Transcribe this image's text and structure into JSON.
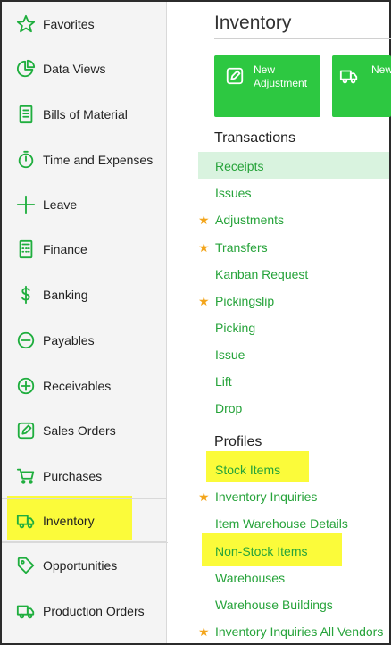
{
  "sidebar": {
    "items": [
      {
        "label": "Favorites",
        "icon": "star-icon"
      },
      {
        "label": "Data Views",
        "icon": "pie-chart-icon"
      },
      {
        "label": "Bills of Material",
        "icon": "document-list-icon"
      },
      {
        "label": "Time and Expenses",
        "icon": "stopwatch-icon"
      },
      {
        "label": "Leave",
        "icon": "plus-icon"
      },
      {
        "label": "Finance",
        "icon": "calculator-icon"
      },
      {
        "label": "Banking",
        "icon": "dollar-icon"
      },
      {
        "label": "Payables",
        "icon": "minus-circle-icon"
      },
      {
        "label": "Receivables",
        "icon": "plus-circle-icon"
      },
      {
        "label": "Sales Orders",
        "icon": "pencil-square-icon"
      },
      {
        "label": "Purchases",
        "icon": "cart-icon"
      },
      {
        "label": "Inventory",
        "icon": "truck-icon"
      },
      {
        "label": "Opportunities",
        "icon": "tag-icon"
      },
      {
        "label": "Production Orders",
        "icon": "truck-icon"
      }
    ],
    "active": "Inventory"
  },
  "main": {
    "title": "Inventory",
    "tiles": [
      {
        "label": "New Adjustment",
        "icon": "pencil-square-icon"
      },
      {
        "label": "New Transfer",
        "icon": "truck-icon"
      }
    ],
    "transactions": {
      "heading": "Transactions",
      "links": [
        {
          "label": "Receipts",
          "starred": false,
          "selected": true
        },
        {
          "label": "Issues",
          "starred": false
        },
        {
          "label": "Adjustments",
          "starred": true
        },
        {
          "label": "Transfers",
          "starred": true
        },
        {
          "label": "Kanban Request",
          "starred": false
        },
        {
          "label": "Pickingslip",
          "starred": true
        },
        {
          "label": "Picking",
          "starred": false
        },
        {
          "label": "Issue",
          "starred": false
        },
        {
          "label": "Lift",
          "starred": false
        },
        {
          "label": "Drop",
          "starred": false
        }
      ]
    },
    "profiles": {
      "heading": "Profiles",
      "links": [
        {
          "label": "Stock Items",
          "starred": false,
          "highlighted": true
        },
        {
          "label": "Inventory Inquiries",
          "starred": true
        },
        {
          "label": "Item Warehouse Details",
          "starred": false
        },
        {
          "label": "Non-Stock Items",
          "starred": false,
          "highlighted": true
        },
        {
          "label": "Warehouses",
          "starred": false
        },
        {
          "label": "Warehouse Buildings",
          "starred": false
        },
        {
          "label": "Inventory Inquiries All Vendors",
          "starred": true
        }
      ]
    }
  },
  "colors": {
    "accent": "#2dc841",
    "link": "#26a33a",
    "star": "#f3a51b",
    "highlight": "#fbfb3a",
    "selected": "#d9f3df"
  }
}
